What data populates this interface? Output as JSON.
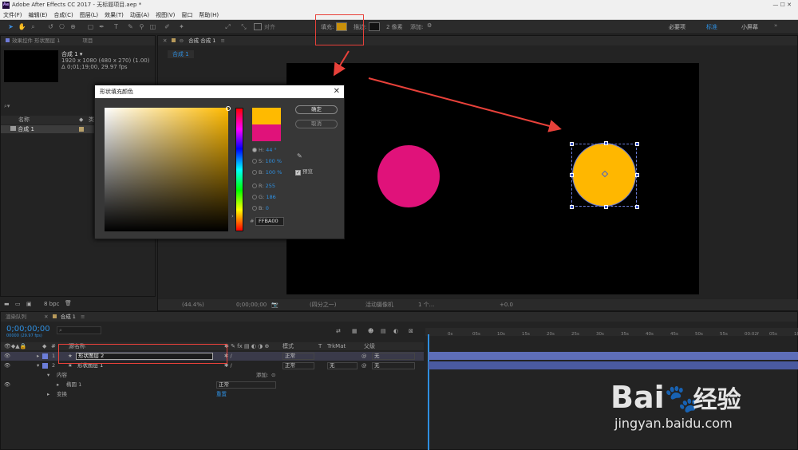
{
  "window": {
    "title": "Adobe After Effects CC 2017 - 无标题项目.aep *",
    "logo_text": "Ae"
  },
  "menu": [
    "文件(F)",
    "编辑(E)",
    "合成(C)",
    "图层(L)",
    "效果(T)",
    "动画(A)",
    "视图(V)",
    "窗口",
    "帮助(H)"
  ],
  "toolbar": {
    "fill_label": "填充:",
    "stroke_label": "描边:",
    "stroke_width": "2 像素",
    "add_label": "添加:",
    "fill_color": "#c8900a",
    "workspaces": [
      "必要项",
      "标准",
      "小屏幕"
    ],
    "active_workspace": "标准",
    "align_label": "对齐"
  },
  "project_panel": {
    "tab_effects": "效果控件 形状图层 1",
    "tab_project": "项目",
    "comp_name": "合成 1 ▾",
    "comp_size": "1920 x 1080  (480 x 270) (1.00)",
    "comp_duration": "Δ 0;01;19;00, 29.97 fps",
    "col_name": "名称",
    "col_type": "类",
    "item_name": "合成 1",
    "bpc": "8 bpc"
  },
  "viewer": {
    "tab_label": "合成 合成 1",
    "breadcrumb": "合成 1",
    "zoom": "(44.4%)",
    "timecode": "0;00;00;00",
    "quality": "(四分之一)",
    "camera": "活动摄像机",
    "views": "1 个...",
    "exposure": "+0.0"
  },
  "color_dialog": {
    "title": "形状填充颜色",
    "ok_label": "确定",
    "cancel_label": "取消",
    "preview_label": "预览",
    "new_color": "#ffba00",
    "old_color": "#e0127a",
    "fields": [
      {
        "label": "H:",
        "value": "44 °",
        "selected": true
      },
      {
        "label": "S:",
        "value": "100 %",
        "selected": false
      },
      {
        "label": "B:",
        "value": "100 %",
        "selected": false
      },
      {
        "label": "R:",
        "value": "255",
        "selected": false
      },
      {
        "label": "G:",
        "value": "186",
        "selected": false
      },
      {
        "label": "B:",
        "value": "0",
        "selected": false
      }
    ],
    "hex_prefix": "#",
    "hex_value": "FFBA00"
  },
  "canvas": {
    "pink_circle_color": "#e0127a",
    "yellow_circle_color": "#ffb700"
  },
  "timeline": {
    "render_tab": "渲染队列",
    "comp_tab": "合成 1",
    "timecode": "0;00;00;00",
    "fps_note": "00000 (29.97 fps)",
    "col_source": "源名称",
    "col_mode": "模式",
    "col_t": "T",
    "col_trkmat": "TrkMat",
    "col_parent": "父级",
    "layers": [
      {
        "num": "1",
        "name": "形状图层 2",
        "mode": "正常",
        "trkmat": "",
        "parent": "无"
      },
      {
        "num": "2",
        "name": "形状图层 1",
        "mode": "正常",
        "trkmat": "无",
        "parent": "无"
      }
    ],
    "content_label": "内容",
    "add_label": "添加:",
    "ellipse_label": "椭圆 1",
    "ellipse_mode": "正常",
    "transform_label": "变换",
    "reset_label": "重置",
    "ruler": [
      "0s",
      "05s",
      "10s",
      "15s",
      "20s",
      "25s",
      "30s",
      "35s",
      "40s",
      "45s",
      "50s",
      "55s",
      "00:02f",
      "05s",
      "10s"
    ]
  },
  "watermark": {
    "brand_latin": "Bai",
    "brand_tail": "经验",
    "url": "jingyan.baidu.com"
  }
}
